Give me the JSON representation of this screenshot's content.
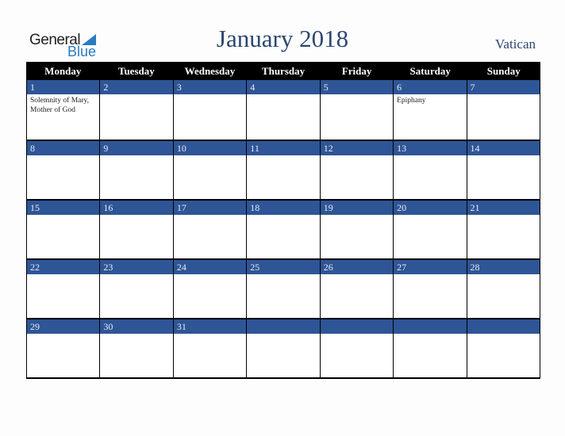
{
  "logo": {
    "general": "General",
    "blue": "Blue"
  },
  "title": "January 2018",
  "country": "Vatican",
  "colors": {
    "header_bg": "#000000",
    "date_band": "#2e5596",
    "title": "#2c4670",
    "logo_blue": "#2b7bbf"
  },
  "weekdays": [
    "Monday",
    "Tuesday",
    "Wednesday",
    "Thursday",
    "Friday",
    "Saturday",
    "Sunday"
  ],
  "weeks": [
    [
      {
        "day": "1",
        "event": "Solemnity of Mary, Mother of God"
      },
      {
        "day": "2",
        "event": ""
      },
      {
        "day": "3",
        "event": ""
      },
      {
        "day": "4",
        "event": ""
      },
      {
        "day": "5",
        "event": ""
      },
      {
        "day": "6",
        "event": "Epiphany"
      },
      {
        "day": "7",
        "event": ""
      }
    ],
    [
      {
        "day": "8",
        "event": ""
      },
      {
        "day": "9",
        "event": ""
      },
      {
        "day": "10",
        "event": ""
      },
      {
        "day": "11",
        "event": ""
      },
      {
        "day": "12",
        "event": ""
      },
      {
        "day": "13",
        "event": ""
      },
      {
        "day": "14",
        "event": ""
      }
    ],
    [
      {
        "day": "15",
        "event": ""
      },
      {
        "day": "16",
        "event": ""
      },
      {
        "day": "17",
        "event": ""
      },
      {
        "day": "18",
        "event": ""
      },
      {
        "day": "19",
        "event": ""
      },
      {
        "day": "20",
        "event": ""
      },
      {
        "day": "21",
        "event": ""
      }
    ],
    [
      {
        "day": "22",
        "event": ""
      },
      {
        "day": "23",
        "event": ""
      },
      {
        "day": "24",
        "event": ""
      },
      {
        "day": "25",
        "event": ""
      },
      {
        "day": "26",
        "event": ""
      },
      {
        "day": "27",
        "event": ""
      },
      {
        "day": "28",
        "event": ""
      }
    ],
    [
      {
        "day": "29",
        "event": ""
      },
      {
        "day": "30",
        "event": ""
      },
      {
        "day": "31",
        "event": ""
      },
      {
        "day": "",
        "event": ""
      },
      {
        "day": "",
        "event": ""
      },
      {
        "day": "",
        "event": ""
      },
      {
        "day": "",
        "event": ""
      }
    ]
  ]
}
